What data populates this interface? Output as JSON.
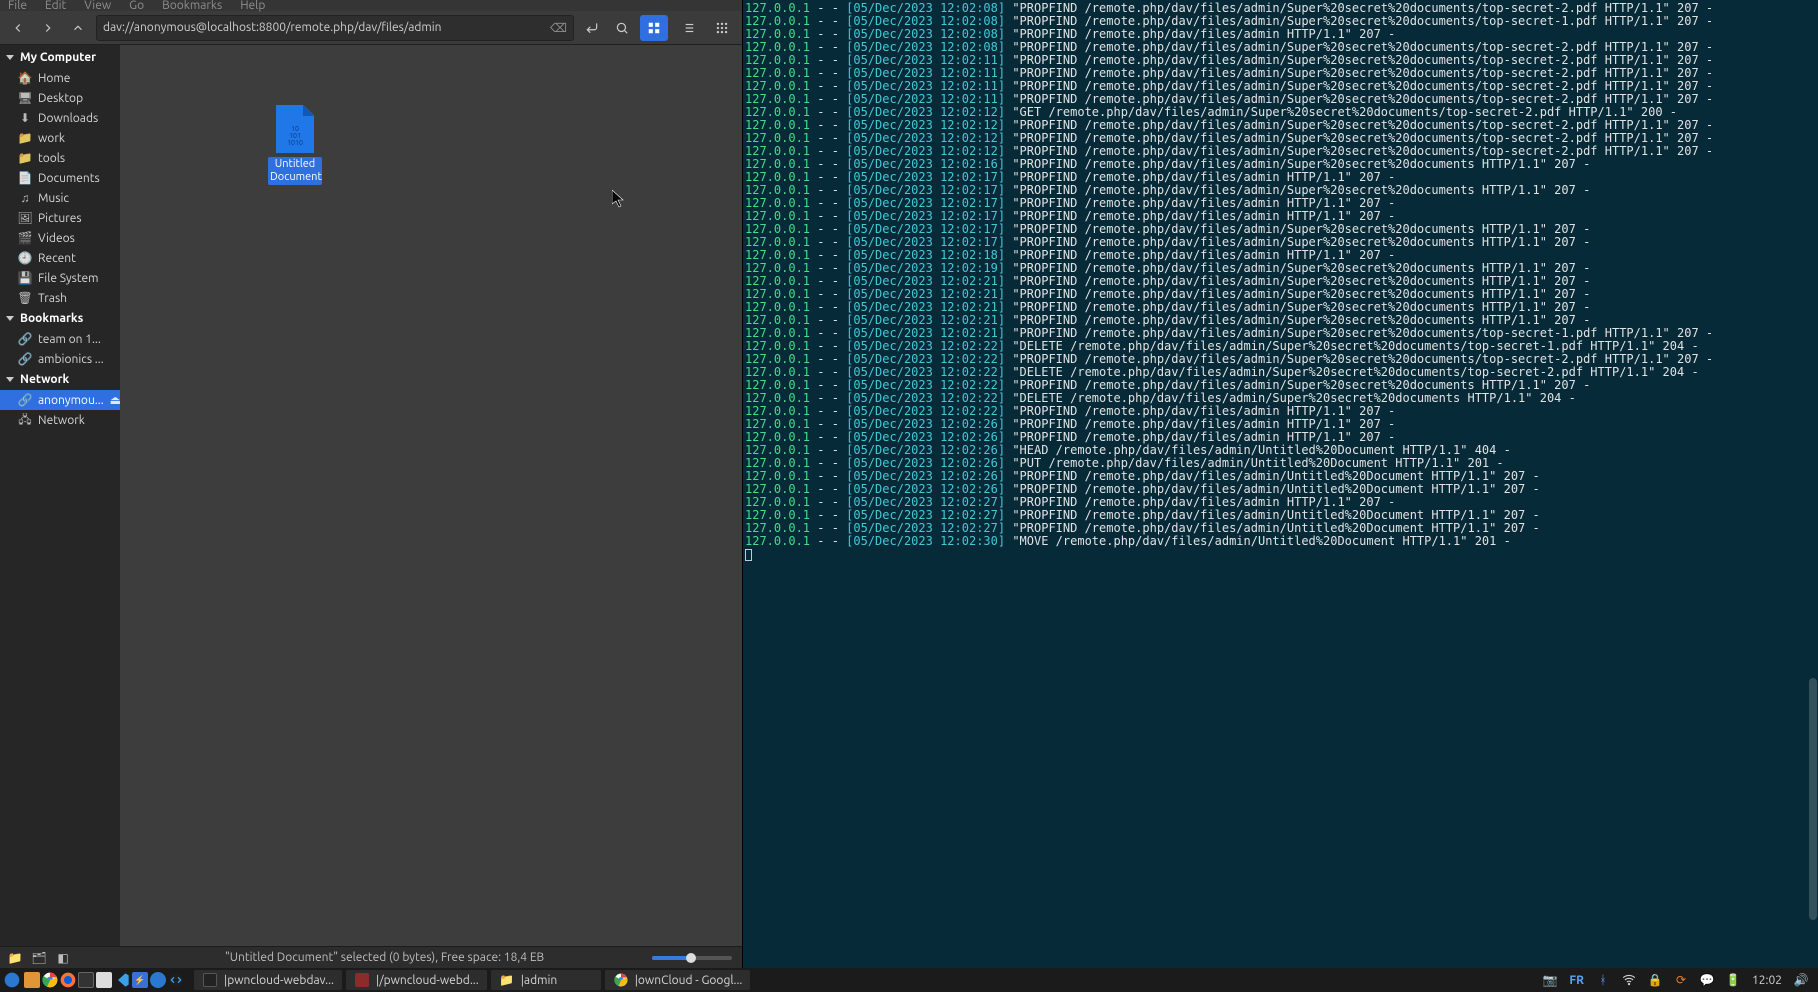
{
  "menubar": {
    "file": "File",
    "edit": "Edit",
    "view": "View",
    "go": "Go",
    "bookmarks": "Bookmarks",
    "help": "Help"
  },
  "path": "dav://anonymous@localhost:8800/remote.php/dav/files/admin",
  "sidebar": {
    "group_my_computer": "My Computer",
    "group_bookmarks": "Bookmarks",
    "group_network": "Network",
    "items": {
      "home": "Home",
      "desktop": "Desktop",
      "downloads": "Downloads",
      "work": "work",
      "tools": "tools",
      "documents": "Documents",
      "music": "Music",
      "pictures": "Pictures",
      "videos": "Videos",
      "recent": "Recent",
      "filesystem": "File System",
      "trash": "Trash",
      "team": "team on 1...",
      "ambionics": "ambionics ...",
      "anonymous": "anonymou...",
      "network": "Network"
    }
  },
  "file": {
    "name": "Untitled Document",
    "bits": "10\n101\n1010"
  },
  "statusbar": {
    "text": "\"Untitled Document\" selected (0 bytes), Free space: 18,4 EB"
  },
  "terminal_lines": [
    "127.0.0.1 - - [05/Dec/2023 12:02:08] \"PROPFIND /remote.php/dav/files/admin/Super%20secret%20documents/top-secret-2.pdf HTTP/1.1\" 207 -",
    "127.0.0.1 - - [05/Dec/2023 12:02:08] \"PROPFIND /remote.php/dav/files/admin/Super%20secret%20documents/top-secret-1.pdf HTTP/1.1\" 207 -",
    "127.0.0.1 - - [05/Dec/2023 12:02:08] \"PROPFIND /remote.php/dav/files/admin HTTP/1.1\" 207 -",
    "127.0.0.1 - - [05/Dec/2023 12:02:08] \"PROPFIND /remote.php/dav/files/admin/Super%20secret%20documents/top-secret-2.pdf HTTP/1.1\" 207 -",
    "127.0.0.1 - - [05/Dec/2023 12:02:11] \"PROPFIND /remote.php/dav/files/admin/Super%20secret%20documents/top-secret-2.pdf HTTP/1.1\" 207 -",
    "127.0.0.1 - - [05/Dec/2023 12:02:11] \"PROPFIND /remote.php/dav/files/admin/Super%20secret%20documents/top-secret-2.pdf HTTP/1.1\" 207 -",
    "127.0.0.1 - - [05/Dec/2023 12:02:11] \"PROPFIND /remote.php/dav/files/admin/Super%20secret%20documents/top-secret-2.pdf HTTP/1.1\" 207 -",
    "127.0.0.1 - - [05/Dec/2023 12:02:11] \"PROPFIND /remote.php/dav/files/admin/Super%20secret%20documents/top-secret-2.pdf HTTP/1.1\" 207 -",
    "127.0.0.1 - - [05/Dec/2023 12:02:12] \"GET /remote.php/dav/files/admin/Super%20secret%20documents/top-secret-2.pdf HTTP/1.1\" 200 -",
    "127.0.0.1 - - [05/Dec/2023 12:02:12] \"PROPFIND /remote.php/dav/files/admin/Super%20secret%20documents/top-secret-2.pdf HTTP/1.1\" 207 -",
    "127.0.0.1 - - [05/Dec/2023 12:02:12] \"PROPFIND /remote.php/dav/files/admin/Super%20secret%20documents/top-secret-2.pdf HTTP/1.1\" 207 -",
    "127.0.0.1 - - [05/Dec/2023 12:02:12] \"PROPFIND /remote.php/dav/files/admin/Super%20secret%20documents/top-secret-2.pdf HTTP/1.1\" 207 -",
    "127.0.0.1 - - [05/Dec/2023 12:02:16] \"PROPFIND /remote.php/dav/files/admin/Super%20secret%20documents HTTP/1.1\" 207 -",
    "127.0.0.1 - - [05/Dec/2023 12:02:17] \"PROPFIND /remote.php/dav/files/admin HTTP/1.1\" 207 -",
    "127.0.0.1 - - [05/Dec/2023 12:02:17] \"PROPFIND /remote.php/dav/files/admin/Super%20secret%20documents HTTP/1.1\" 207 -",
    "127.0.0.1 - - [05/Dec/2023 12:02:17] \"PROPFIND /remote.php/dav/files/admin HTTP/1.1\" 207 -",
    "127.0.0.1 - - [05/Dec/2023 12:02:17] \"PROPFIND /remote.php/dav/files/admin HTTP/1.1\" 207 -",
    "127.0.0.1 - - [05/Dec/2023 12:02:17] \"PROPFIND /remote.php/dav/files/admin/Super%20secret%20documents HTTP/1.1\" 207 -",
    "127.0.0.1 - - [05/Dec/2023 12:02:17] \"PROPFIND /remote.php/dav/files/admin/Super%20secret%20documents HTTP/1.1\" 207 -",
    "127.0.0.1 - - [05/Dec/2023 12:02:18] \"PROPFIND /remote.php/dav/files/admin HTTP/1.1\" 207 -",
    "127.0.0.1 - - [05/Dec/2023 12:02:19] \"PROPFIND /remote.php/dav/files/admin/Super%20secret%20documents HTTP/1.1\" 207 -",
    "127.0.0.1 - - [05/Dec/2023 12:02:21] \"PROPFIND /remote.php/dav/files/admin/Super%20secret%20documents HTTP/1.1\" 207 -",
    "127.0.0.1 - - [05/Dec/2023 12:02:21] \"PROPFIND /remote.php/dav/files/admin/Super%20secret%20documents HTTP/1.1\" 207 -",
    "127.0.0.1 - - [05/Dec/2023 12:02:21] \"PROPFIND /remote.php/dav/files/admin/Super%20secret%20documents HTTP/1.1\" 207 -",
    "127.0.0.1 - - [05/Dec/2023 12:02:21] \"PROPFIND /remote.php/dav/files/admin/Super%20secret%20documents HTTP/1.1\" 207 -",
    "127.0.0.1 - - [05/Dec/2023 12:02:21] \"PROPFIND /remote.php/dav/files/admin/Super%20secret%20documents/top-secret-1.pdf HTTP/1.1\" 207 -",
    "127.0.0.1 - - [05/Dec/2023 12:02:22] \"DELETE /remote.php/dav/files/admin/Super%20secret%20documents/top-secret-1.pdf HTTP/1.1\" 204 -",
    "127.0.0.1 - - [05/Dec/2023 12:02:22] \"PROPFIND /remote.php/dav/files/admin/Super%20secret%20documents/top-secret-2.pdf HTTP/1.1\" 207 -",
    "127.0.0.1 - - [05/Dec/2023 12:02:22] \"DELETE /remote.php/dav/files/admin/Super%20secret%20documents/top-secret-2.pdf HTTP/1.1\" 204 -",
    "127.0.0.1 - - [05/Dec/2023 12:02:22] \"PROPFIND /remote.php/dav/files/admin/Super%20secret%20documents HTTP/1.1\" 207 -",
    "127.0.0.1 - - [05/Dec/2023 12:02:22] \"DELETE /remote.php/dav/files/admin/Super%20secret%20documents HTTP/1.1\" 204 -",
    "127.0.0.1 - - [05/Dec/2023 12:02:22] \"PROPFIND /remote.php/dav/files/admin HTTP/1.1\" 207 -",
    "127.0.0.1 - - [05/Dec/2023 12:02:26] \"PROPFIND /remote.php/dav/files/admin HTTP/1.1\" 207 -",
    "127.0.0.1 - - [05/Dec/2023 12:02:26] \"PROPFIND /remote.php/dav/files/admin HTTP/1.1\" 207 -",
    "127.0.0.1 - - [05/Dec/2023 12:02:26] \"HEAD /remote.php/dav/files/admin/Untitled%20Document HTTP/1.1\" 404 -",
    "127.0.0.1 - - [05/Dec/2023 12:02:26] \"PUT /remote.php/dav/files/admin/Untitled%20Document HTTP/1.1\" 201 -",
    "127.0.0.1 - - [05/Dec/2023 12:02:26] \"PROPFIND /remote.php/dav/files/admin/Untitled%20Document HTTP/1.1\" 207 -",
    "127.0.0.1 - - [05/Dec/2023 12:02:26] \"PROPFIND /remote.php/dav/files/admin/Untitled%20Document HTTP/1.1\" 207 -",
    "127.0.0.1 - - [05/Dec/2023 12:02:27] \"PROPFIND /remote.php/dav/files/admin HTTP/1.1\" 207 -",
    "127.0.0.1 - - [05/Dec/2023 12:02:27] \"PROPFIND /remote.php/dav/files/admin/Untitled%20Document HTTP/1.1\" 207 -",
    "127.0.0.1 - - [05/Dec/2023 12:02:27] \"PROPFIND /remote.php/dav/files/admin/Untitled%20Document HTTP/1.1\" 207 -",
    "127.0.0.1 - - [05/Dec/2023 12:02:30] \"MOVE /remote.php/dav/files/admin/Untitled%20Document HTTP/1.1\" 201 -"
  ],
  "taskbar": {
    "apps": [
      {
        "label": "|pwncloud-webdav...",
        "icon": "terminal"
      },
      {
        "label": "|/pwncloud-webd...",
        "icon": "terminal-red"
      },
      {
        "label": "|admin",
        "icon": "folder"
      },
      {
        "label": "|ownCloud - Googl...",
        "icon": "chrome"
      }
    ],
    "lang": "FR",
    "clock": "12:02"
  }
}
